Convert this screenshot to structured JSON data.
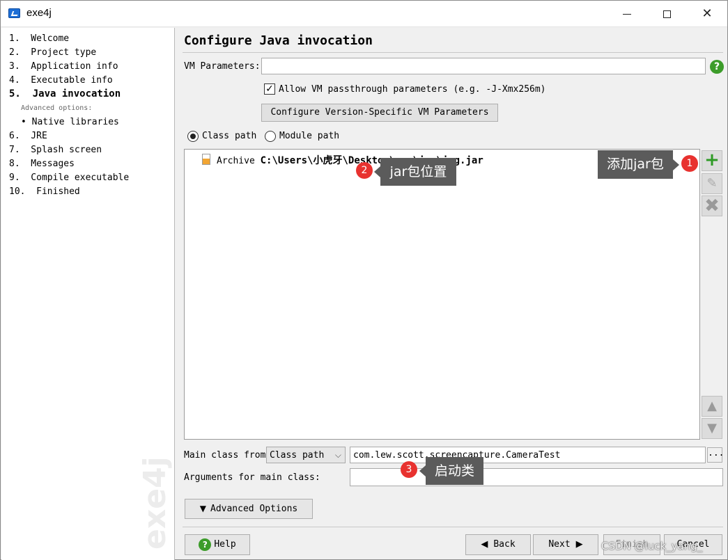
{
  "window": {
    "title": "exe4j",
    "minimize": "—",
    "maximize": "□",
    "close": "✕"
  },
  "sidebar": {
    "steps": [
      "1.  Welcome",
      "2.  Project type",
      "3.  Application info",
      "4.  Executable info",
      "5.  Java invocation",
      "• Native libraries",
      "6.  JRE",
      "7.  Splash screen",
      "8.  Messages",
      "9.  Compile executable",
      "10.  Finished"
    ],
    "advanced_label": "Advanced options:",
    "watermark": "exe4j"
  },
  "main": {
    "heading": "Configure Java invocation",
    "vm_params_label": "VM Parameters:",
    "vm_params_value": "",
    "help_icon": "?",
    "allow_passthrough_label": "Allow VM passthrough parameters (e.g. -J-Xmx256m)",
    "allow_passthrough_checked": true,
    "configure_version_button": "Configure Version-Specific VM Parameters",
    "class_path_radio": "Class path",
    "module_path_radio": "Module path",
    "selected_path_type": "Class path",
    "archive_label": "Archive",
    "archive_path": "C:\\Users\\小虎牙\\Desktop\\exe\\jpg\\jpg.jar",
    "side_buttons": {
      "add": "+",
      "edit": "✎",
      "remove": "✖",
      "up": "▲",
      "down": "▼"
    },
    "main_class_from_label": "Main class from",
    "main_class_source": "Class path",
    "main_class_value": "com.lew.scott.screencapture.CameraTest",
    "browse_button": "...",
    "arguments_label": "Arguments for main class:",
    "arguments_value": "",
    "advanced_options_button": "Advanced Options",
    "advanced_options_arrow": "▼"
  },
  "footer": {
    "help_button": "Help",
    "back_button": "Back",
    "next_button": "Next",
    "finish_button": "Finish",
    "cancel_button": "Cancel"
  },
  "annotations": {
    "one": {
      "number": "1",
      "text": "添加jar包"
    },
    "two": {
      "number": "2",
      "text": "jar包位置"
    },
    "three": {
      "number": "3",
      "text": "启动类"
    }
  },
  "watermark_credit": "CSDN @luck_yang_"
}
